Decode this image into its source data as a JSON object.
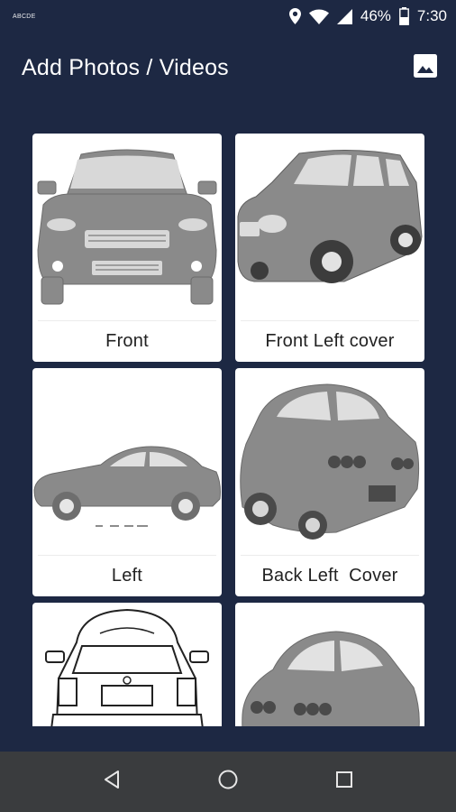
{
  "status_bar": {
    "notification_text": "ABCDE",
    "battery": "46%",
    "time": "7:30",
    "icons": [
      "location-icon",
      "wifi-icon",
      "signal-icon",
      "battery-icon"
    ]
  },
  "app_bar": {
    "title": "Add Photos / Videos",
    "gallery_icon": "image-icon"
  },
  "cards": [
    {
      "label": "Front",
      "image": "car-front"
    },
    {
      "label": "Front Left cover",
      "image": "car-front-left"
    },
    {
      "label": "Left",
      "image": "car-left"
    },
    {
      "label": "Back Left  Cover",
      "image": "car-back-left"
    },
    {
      "label": "",
      "image": "car-back"
    },
    {
      "label": "",
      "image": "car-back-right"
    }
  ],
  "nav_bar": {
    "icons": [
      "back-icon",
      "home-icon",
      "recents-icon"
    ]
  },
  "colors": {
    "background": "#1d2843",
    "card": "#ffffff",
    "car_gray": "#8a8a8a",
    "nav_bar": "#3a3c3e"
  }
}
